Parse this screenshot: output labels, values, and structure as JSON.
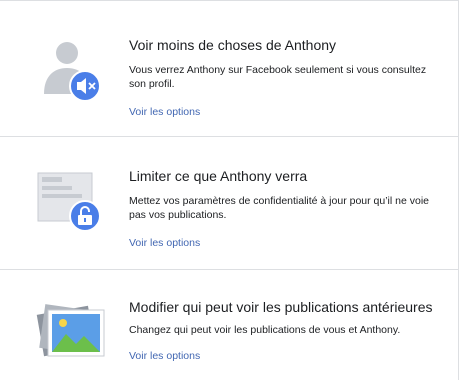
{
  "options": [
    {
      "title": "Voir moins de choses de Anthony",
      "description": "Vous verrez Anthony sur Facebook seulement si vous consultez son profil.",
      "link": "Voir les options",
      "icon": "muted-person-icon"
    },
    {
      "title": "Limiter ce que Anthony verra",
      "description": "Mettez vos paramètres de confidentialité à jour pour qu’il ne voie pas vos publications.",
      "link": "Voir les options",
      "icon": "privacy-lock-icon"
    },
    {
      "title": "Modifier qui peut voir les publications antérieures",
      "description": "Changez qui peut voir les publications de vous et Anthony.",
      "link": "Voir les options",
      "icon": "photos-icon"
    }
  ],
  "colors": {
    "accent": "#4267b2",
    "badge": "#4a7ee8",
    "divider": "#dddfe2",
    "illustration_gray": "#c7cbd1"
  }
}
